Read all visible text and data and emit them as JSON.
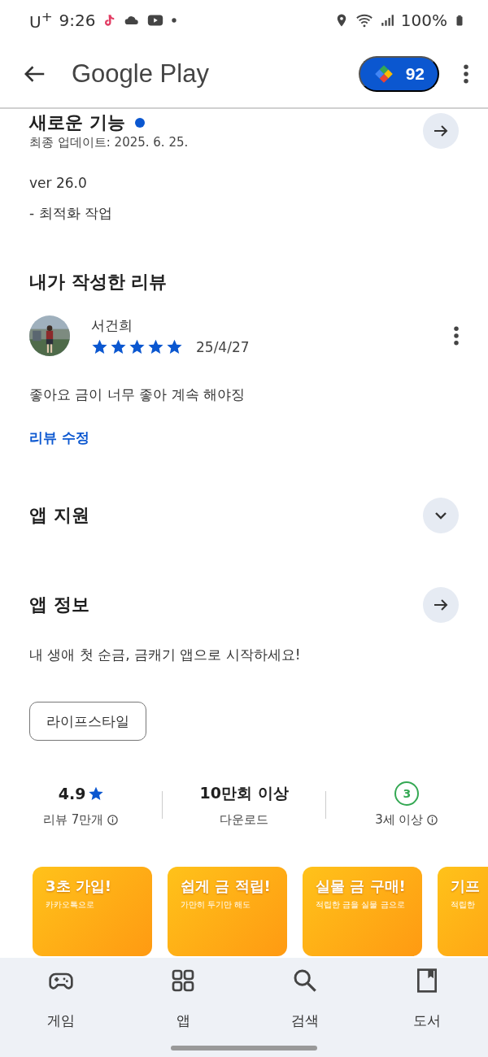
{
  "status_bar": {
    "carrier": "U$^{+}$",
    "time": "9:26",
    "battery": "100%"
  },
  "app_bar": {
    "title": "Google Play",
    "points": "92"
  },
  "whats_new": {
    "title": "새로운 기능",
    "new": true,
    "updated": "최종 업데이트: 2025. 6. 25.",
    "lines": [
      "ver 26.0",
      "- 최적화 작업"
    ]
  },
  "my_review": {
    "title": "내가 작성한 리뷰",
    "author": "서건희",
    "stars": 5,
    "date": "25/4/27",
    "text": "좋아요 금이 너무 좋아 계속 해야징",
    "edit_link": "리뷰 수정"
  },
  "app_support": {
    "title": "앱 지원",
    "expanded": false
  },
  "app_info": {
    "title": "앱 정보",
    "description": "내 생애 첫 순금, 금캐기 앱으로 시작하세요!",
    "tags": [
      "라이프스타일"
    ]
  },
  "stats": [
    {
      "kind": "rating",
      "value": "4.9",
      "label": "리뷰 7만개",
      "info": true
    },
    {
      "kind": "text",
      "value": "10만회 이상",
      "label": "다운로드",
      "info": false
    },
    {
      "kind": "age",
      "value": "3",
      "label": "3세 이상",
      "info": true
    }
  ],
  "screenshots": [
    {
      "title": "3초 가입!",
      "subtitle": "카카오톡으로"
    },
    {
      "title": "쉽게 금 적립!",
      "subtitle": "가만히 두기만 해도"
    },
    {
      "title": "실물 금 구매!",
      "subtitle": "적립한 금을 실물 금으로"
    },
    {
      "title": "기프",
      "subtitle": "적립한"
    }
  ],
  "nav": [
    {
      "label": "게임",
      "kind": "games",
      "selected": false
    },
    {
      "label": "앱",
      "kind": "apps",
      "selected": false
    },
    {
      "label": "검색",
      "kind": "search",
      "selected": false
    },
    {
      "label": "도서",
      "kind": "books",
      "selected": false
    }
  ]
}
